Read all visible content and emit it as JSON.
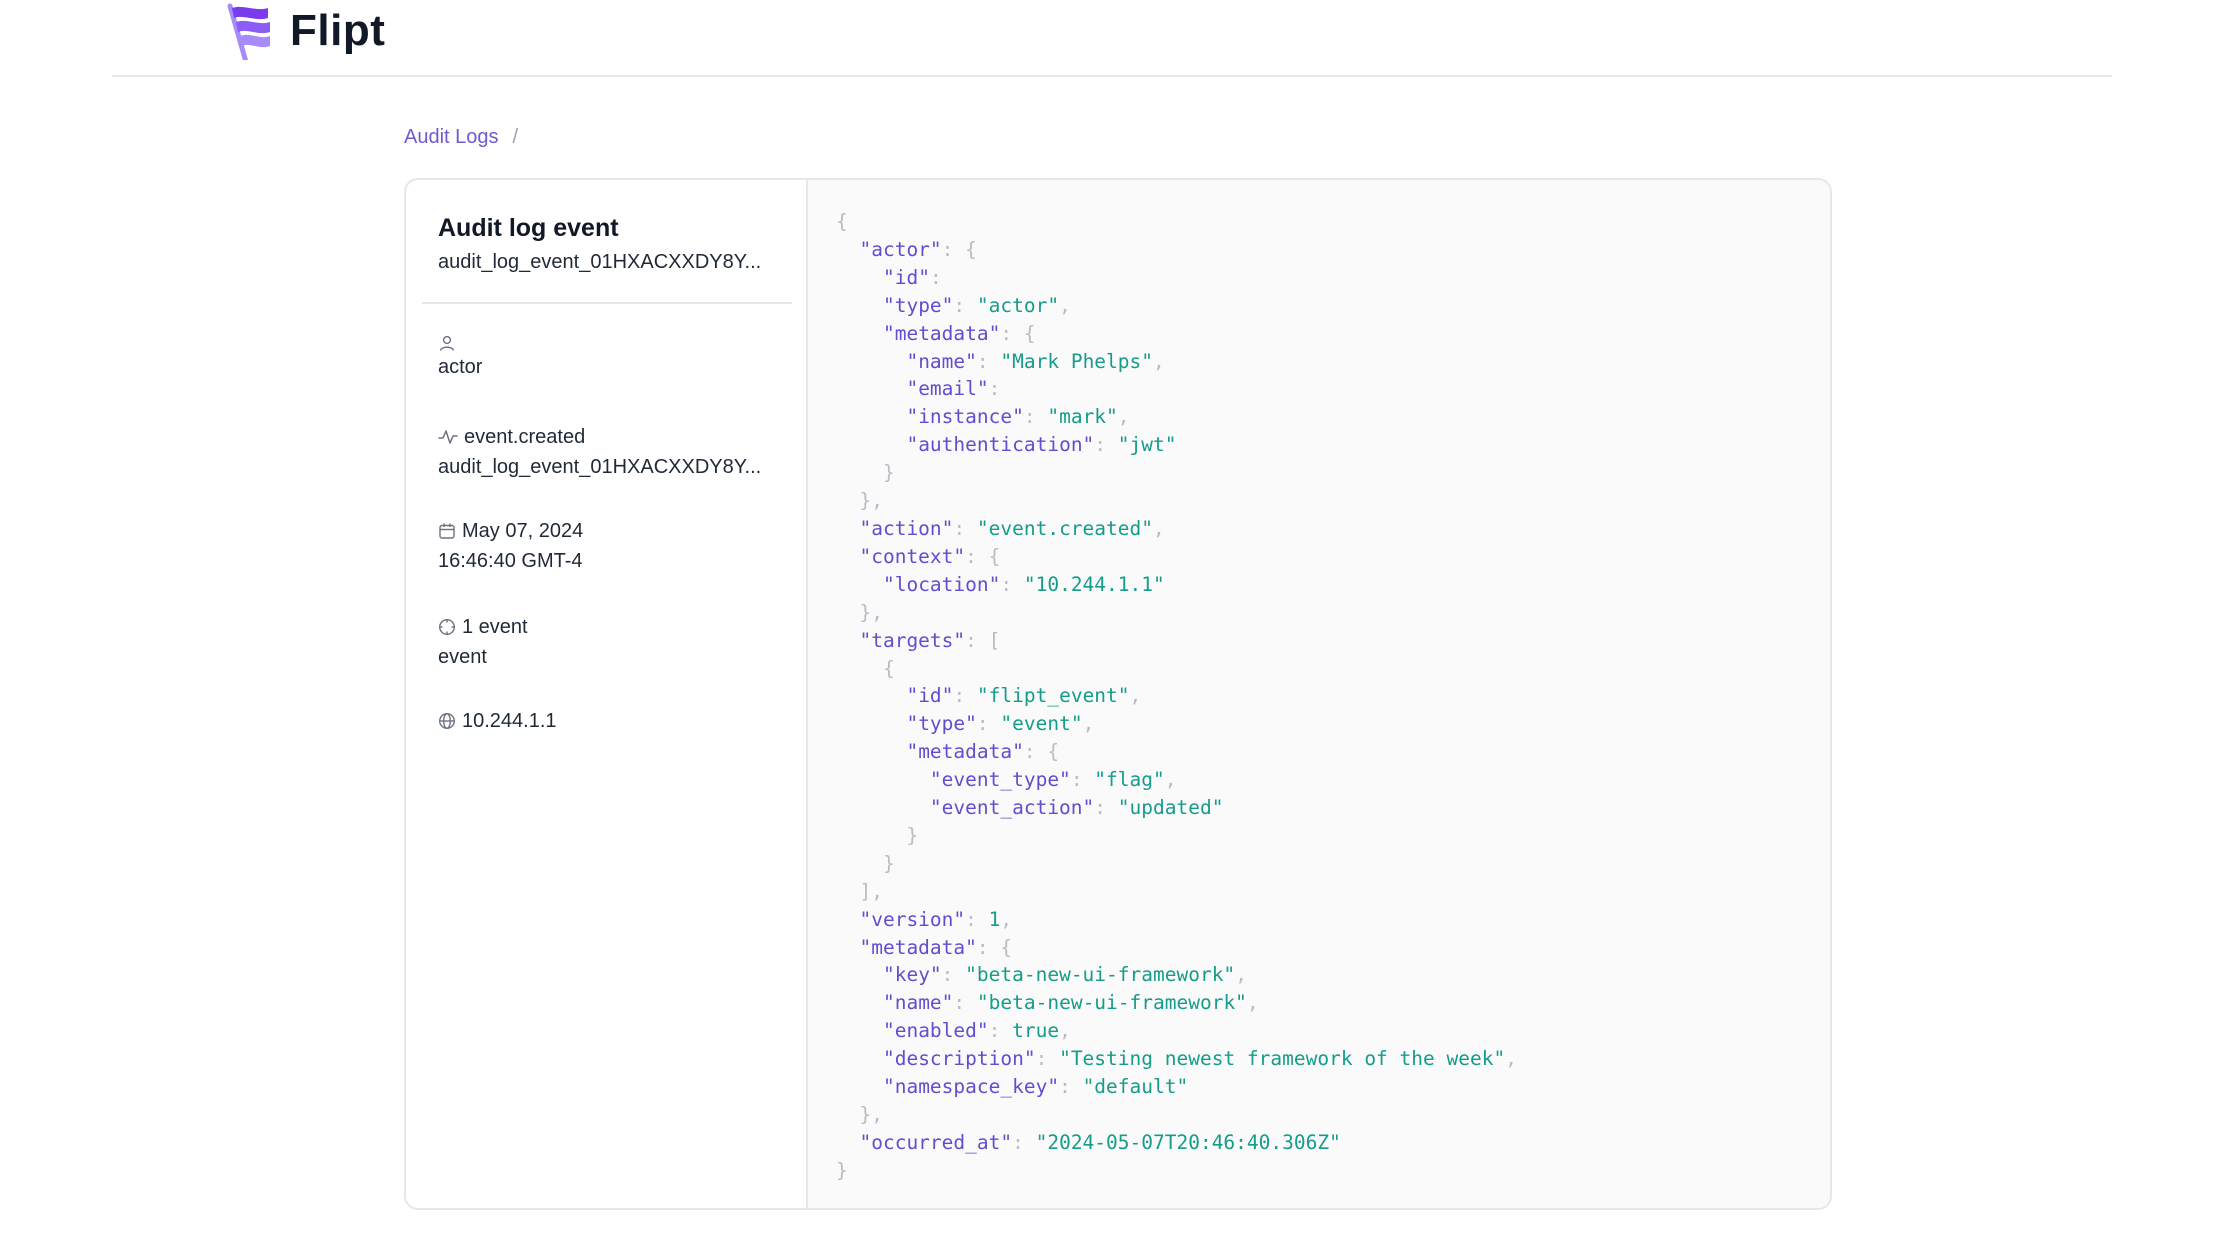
{
  "app": {
    "name": "Flipt"
  },
  "breadcrumb": {
    "root": "Audit Logs",
    "separator": "/",
    "current": ""
  },
  "sidebar": {
    "title": "Audit log event",
    "subtitle": "audit_log_event_01HXACXXDY8Y...",
    "actor": {
      "icon": "user-icon",
      "label": "",
      "value": "actor"
    },
    "action": {
      "icon": "activity-icon",
      "label": "event.created",
      "value": "audit_log_event_01HXACXXDY8Y..."
    },
    "date": {
      "icon": "calendar-icon",
      "label": "May 07, 2024",
      "value": "16:46:40 GMT-4"
    },
    "targets": {
      "icon": "target-icon",
      "label": "1 event",
      "value": "event"
    },
    "location": {
      "icon": "globe-icon",
      "label": "10.244.1.1"
    }
  },
  "json_lines": [
    [
      [
        "p",
        "{"
      ]
    ],
    [
      [
        "i",
        "  "
      ],
      [
        "k",
        "\"actor\""
      ],
      [
        "p",
        ": {"
      ]
    ],
    [
      [
        "i",
        "    "
      ],
      [
        "k",
        "\"id\""
      ],
      [
        "p",
        ":"
      ]
    ],
    [
      [
        "i",
        "    "
      ],
      [
        "k",
        "\"type\""
      ],
      [
        "p",
        ": "
      ],
      [
        "s",
        "\"actor\""
      ],
      [
        "p",
        ","
      ]
    ],
    [
      [
        "i",
        "    "
      ],
      [
        "k",
        "\"metadata\""
      ],
      [
        "p",
        ": {"
      ]
    ],
    [
      [
        "i",
        "      "
      ],
      [
        "k",
        "\"name\""
      ],
      [
        "p",
        ": "
      ],
      [
        "s",
        "\"Mark Phelps\""
      ],
      [
        "p",
        ","
      ]
    ],
    [
      [
        "i",
        "      "
      ],
      [
        "k",
        "\"email\""
      ],
      [
        "p",
        ":"
      ]
    ],
    [
      [
        "i",
        "      "
      ],
      [
        "k",
        "\"instance\""
      ],
      [
        "p",
        ": "
      ],
      [
        "s",
        "\"mark\""
      ],
      [
        "p",
        ","
      ]
    ],
    [
      [
        "i",
        "      "
      ],
      [
        "k",
        "\"authentication\""
      ],
      [
        "p",
        ": "
      ],
      [
        "s",
        "\"jwt\""
      ]
    ],
    [
      [
        "i",
        "    "
      ],
      [
        "p",
        "}"
      ]
    ],
    [
      [
        "i",
        "  "
      ],
      [
        "p",
        "},"
      ]
    ],
    [
      [
        "i",
        "  "
      ],
      [
        "k",
        "\"action\""
      ],
      [
        "p",
        ": "
      ],
      [
        "s",
        "\"event.created\""
      ],
      [
        "p",
        ","
      ]
    ],
    [
      [
        "i",
        "  "
      ],
      [
        "k",
        "\"context\""
      ],
      [
        "p",
        ": {"
      ]
    ],
    [
      [
        "i",
        "    "
      ],
      [
        "k",
        "\"location\""
      ],
      [
        "p",
        ": "
      ],
      [
        "s",
        "\"10.244.1.1\""
      ]
    ],
    [
      [
        "i",
        "  "
      ],
      [
        "p",
        "},"
      ]
    ],
    [
      [
        "i",
        "  "
      ],
      [
        "k",
        "\"targets\""
      ],
      [
        "p",
        ": ["
      ]
    ],
    [
      [
        "i",
        "    "
      ],
      [
        "p",
        "{"
      ]
    ],
    [
      [
        "i",
        "      "
      ],
      [
        "k",
        "\"id\""
      ],
      [
        "p",
        ": "
      ],
      [
        "s",
        "\"flipt_event\""
      ],
      [
        "p",
        ","
      ]
    ],
    [
      [
        "i",
        "      "
      ],
      [
        "k",
        "\"type\""
      ],
      [
        "p",
        ": "
      ],
      [
        "s",
        "\"event\""
      ],
      [
        "p",
        ","
      ]
    ],
    [
      [
        "i",
        "      "
      ],
      [
        "k",
        "\"metadata\""
      ],
      [
        "p",
        ": {"
      ]
    ],
    [
      [
        "i",
        "        "
      ],
      [
        "k",
        "\"event_type\""
      ],
      [
        "p",
        ": "
      ],
      [
        "s",
        "\"flag\""
      ],
      [
        "p",
        ","
      ]
    ],
    [
      [
        "i",
        "        "
      ],
      [
        "k",
        "\"event_action\""
      ],
      [
        "p",
        ": "
      ],
      [
        "s",
        "\"updated\""
      ]
    ],
    [
      [
        "i",
        "      "
      ],
      [
        "p",
        "}"
      ]
    ],
    [
      [
        "i",
        "    "
      ],
      [
        "p",
        "}"
      ]
    ],
    [
      [
        "i",
        "  "
      ],
      [
        "p",
        "],"
      ]
    ],
    [
      [
        "i",
        "  "
      ],
      [
        "k",
        "\"version\""
      ],
      [
        "p",
        ": "
      ],
      [
        "n",
        "1"
      ],
      [
        "p",
        ","
      ]
    ],
    [
      [
        "i",
        "  "
      ],
      [
        "k",
        "\"metadata\""
      ],
      [
        "p",
        ": {"
      ]
    ],
    [
      [
        "i",
        "    "
      ],
      [
        "k",
        "\"key\""
      ],
      [
        "p",
        ": "
      ],
      [
        "s",
        "\"beta-new-ui-framework\""
      ],
      [
        "p",
        ","
      ]
    ],
    [
      [
        "i",
        "    "
      ],
      [
        "k",
        "\"name\""
      ],
      [
        "p",
        ": "
      ],
      [
        "s",
        "\"beta-new-ui-framework\""
      ],
      [
        "p",
        ","
      ]
    ],
    [
      [
        "i",
        "    "
      ],
      [
        "k",
        "\"enabled\""
      ],
      [
        "p",
        ": "
      ],
      [
        "n",
        "true"
      ],
      [
        "p",
        ","
      ]
    ],
    [
      [
        "i",
        "    "
      ],
      [
        "k",
        "\"description\""
      ],
      [
        "p",
        ": "
      ],
      [
        "s",
        "\"Testing newest framework of the week\""
      ],
      [
        "p",
        ","
      ]
    ],
    [
      [
        "i",
        "    "
      ],
      [
        "k",
        "\"namespace_key\""
      ],
      [
        "p",
        ": "
      ],
      [
        "s",
        "\"default\""
      ]
    ],
    [
      [
        "i",
        "  "
      ],
      [
        "p",
        "},"
      ]
    ],
    [
      [
        "i",
        "  "
      ],
      [
        "k",
        "\"occurred_at\""
      ],
      [
        "p",
        ": "
      ],
      [
        "s",
        "\"2024-05-07T20:46:40.306Z\""
      ]
    ],
    [
      [
        "p",
        "}"
      ]
    ]
  ]
}
